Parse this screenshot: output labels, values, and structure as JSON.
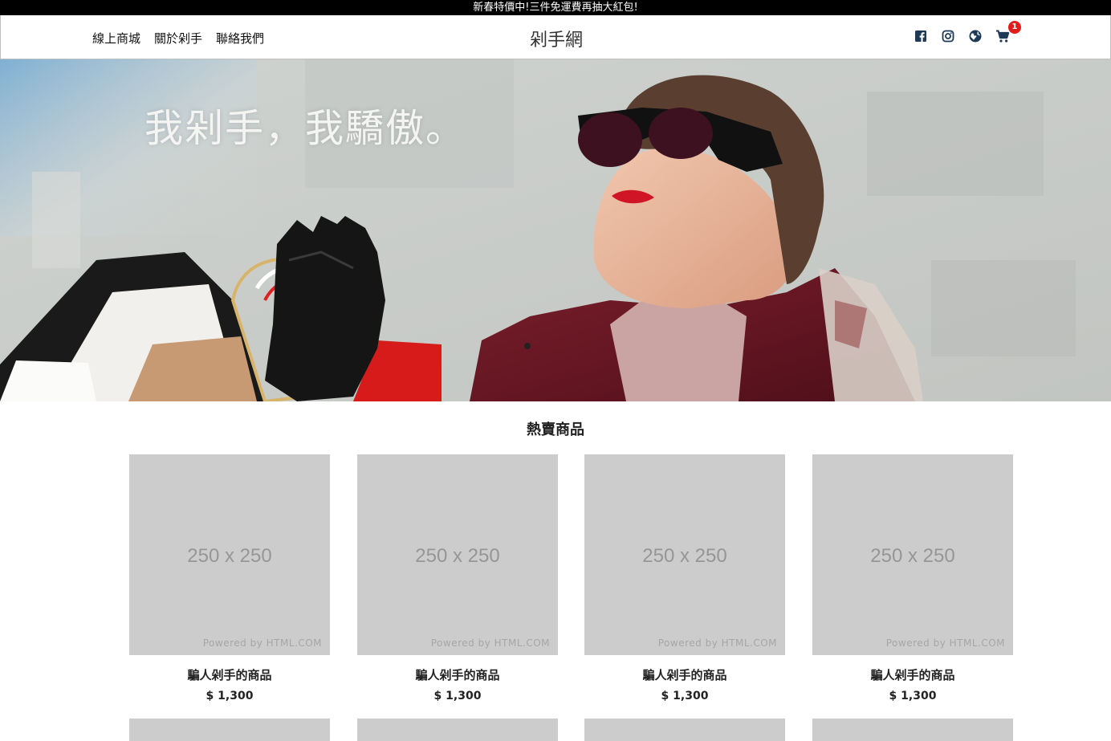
{
  "promo": {
    "text": "新春特價中!三件免運費再抽大紅包!"
  },
  "nav": {
    "links": [
      "線上商城",
      "關於剁手",
      "聯絡我們"
    ],
    "brand": "剁手網",
    "icons": [
      "facebook-icon",
      "instagram-icon",
      "globe-icon",
      "cart-icon"
    ],
    "cart_count": "1",
    "badge_color": "#e21b1b",
    "icon_color": "#1f3a57"
  },
  "hero": {
    "slogan": "我剁手，我驕傲。",
    "image": "woman-with-sunglasses-and-shopping-bags"
  },
  "section": {
    "title": "熱賣商品"
  },
  "products": [
    {
      "placeholder": "250 x 250",
      "powered": "Powered by HTML.COM",
      "name": "騙人剁手的商品",
      "price": "$ 1,300"
    },
    {
      "placeholder": "250 x 250",
      "powered": "Powered by HTML.COM",
      "name": "騙人剁手的商品",
      "price": "$ 1,300"
    },
    {
      "placeholder": "250 x 250",
      "powered": "Powered by HTML.COM",
      "name": "騙人剁手的商品",
      "price": "$ 1,300"
    },
    {
      "placeholder": "250 x 250",
      "powered": "Powered by HTML.COM",
      "name": "騙人剁手的商品",
      "price": "$ 1,300"
    }
  ]
}
